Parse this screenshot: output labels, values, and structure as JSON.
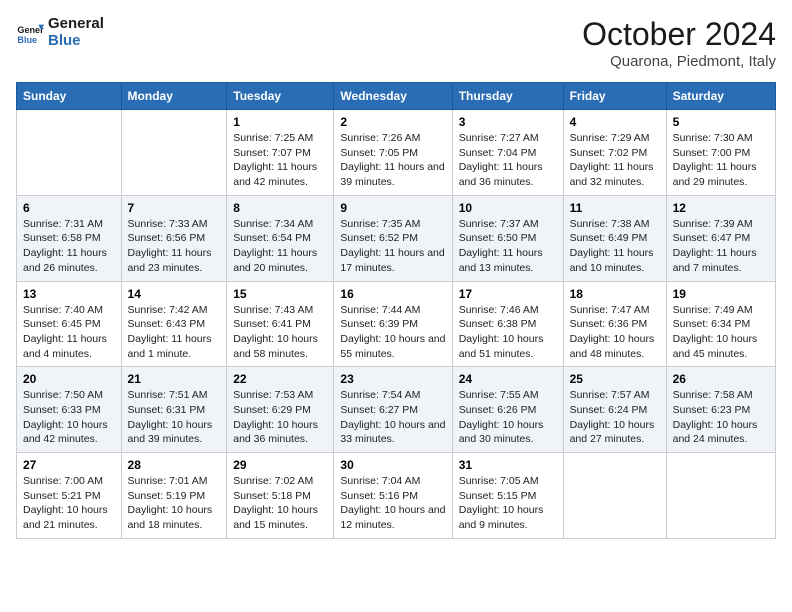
{
  "header": {
    "logo_line1": "General",
    "logo_line2": "Blue",
    "title": "October 2024",
    "subtitle": "Quarona, Piedmont, Italy"
  },
  "days_of_week": [
    "Sunday",
    "Monday",
    "Tuesday",
    "Wednesday",
    "Thursday",
    "Friday",
    "Saturday"
  ],
  "weeks": [
    [
      {
        "day": "",
        "info": ""
      },
      {
        "day": "",
        "info": ""
      },
      {
        "day": "1",
        "info": "Sunrise: 7:25 AM\nSunset: 7:07 PM\nDaylight: 11 hours and 42 minutes."
      },
      {
        "day": "2",
        "info": "Sunrise: 7:26 AM\nSunset: 7:05 PM\nDaylight: 11 hours and 39 minutes."
      },
      {
        "day": "3",
        "info": "Sunrise: 7:27 AM\nSunset: 7:04 PM\nDaylight: 11 hours and 36 minutes."
      },
      {
        "day": "4",
        "info": "Sunrise: 7:29 AM\nSunset: 7:02 PM\nDaylight: 11 hours and 32 minutes."
      },
      {
        "day": "5",
        "info": "Sunrise: 7:30 AM\nSunset: 7:00 PM\nDaylight: 11 hours and 29 minutes."
      }
    ],
    [
      {
        "day": "6",
        "info": "Sunrise: 7:31 AM\nSunset: 6:58 PM\nDaylight: 11 hours and 26 minutes."
      },
      {
        "day": "7",
        "info": "Sunrise: 7:33 AM\nSunset: 6:56 PM\nDaylight: 11 hours and 23 minutes."
      },
      {
        "day": "8",
        "info": "Sunrise: 7:34 AM\nSunset: 6:54 PM\nDaylight: 11 hours and 20 minutes."
      },
      {
        "day": "9",
        "info": "Sunrise: 7:35 AM\nSunset: 6:52 PM\nDaylight: 11 hours and 17 minutes."
      },
      {
        "day": "10",
        "info": "Sunrise: 7:37 AM\nSunset: 6:50 PM\nDaylight: 11 hours and 13 minutes."
      },
      {
        "day": "11",
        "info": "Sunrise: 7:38 AM\nSunset: 6:49 PM\nDaylight: 11 hours and 10 minutes."
      },
      {
        "day": "12",
        "info": "Sunrise: 7:39 AM\nSunset: 6:47 PM\nDaylight: 11 hours and 7 minutes."
      }
    ],
    [
      {
        "day": "13",
        "info": "Sunrise: 7:40 AM\nSunset: 6:45 PM\nDaylight: 11 hours and 4 minutes."
      },
      {
        "day": "14",
        "info": "Sunrise: 7:42 AM\nSunset: 6:43 PM\nDaylight: 11 hours and 1 minute."
      },
      {
        "day": "15",
        "info": "Sunrise: 7:43 AM\nSunset: 6:41 PM\nDaylight: 10 hours and 58 minutes."
      },
      {
        "day": "16",
        "info": "Sunrise: 7:44 AM\nSunset: 6:39 PM\nDaylight: 10 hours and 55 minutes."
      },
      {
        "day": "17",
        "info": "Sunrise: 7:46 AM\nSunset: 6:38 PM\nDaylight: 10 hours and 51 minutes."
      },
      {
        "day": "18",
        "info": "Sunrise: 7:47 AM\nSunset: 6:36 PM\nDaylight: 10 hours and 48 minutes."
      },
      {
        "day": "19",
        "info": "Sunrise: 7:49 AM\nSunset: 6:34 PM\nDaylight: 10 hours and 45 minutes."
      }
    ],
    [
      {
        "day": "20",
        "info": "Sunrise: 7:50 AM\nSunset: 6:33 PM\nDaylight: 10 hours and 42 minutes."
      },
      {
        "day": "21",
        "info": "Sunrise: 7:51 AM\nSunset: 6:31 PM\nDaylight: 10 hours and 39 minutes."
      },
      {
        "day": "22",
        "info": "Sunrise: 7:53 AM\nSunset: 6:29 PM\nDaylight: 10 hours and 36 minutes."
      },
      {
        "day": "23",
        "info": "Sunrise: 7:54 AM\nSunset: 6:27 PM\nDaylight: 10 hours and 33 minutes."
      },
      {
        "day": "24",
        "info": "Sunrise: 7:55 AM\nSunset: 6:26 PM\nDaylight: 10 hours and 30 minutes."
      },
      {
        "day": "25",
        "info": "Sunrise: 7:57 AM\nSunset: 6:24 PM\nDaylight: 10 hours and 27 minutes."
      },
      {
        "day": "26",
        "info": "Sunrise: 7:58 AM\nSunset: 6:23 PM\nDaylight: 10 hours and 24 minutes."
      }
    ],
    [
      {
        "day": "27",
        "info": "Sunrise: 7:00 AM\nSunset: 5:21 PM\nDaylight: 10 hours and 21 minutes."
      },
      {
        "day": "28",
        "info": "Sunrise: 7:01 AM\nSunset: 5:19 PM\nDaylight: 10 hours and 18 minutes."
      },
      {
        "day": "29",
        "info": "Sunrise: 7:02 AM\nSunset: 5:18 PM\nDaylight: 10 hours and 15 minutes."
      },
      {
        "day": "30",
        "info": "Sunrise: 7:04 AM\nSunset: 5:16 PM\nDaylight: 10 hours and 12 minutes."
      },
      {
        "day": "31",
        "info": "Sunrise: 7:05 AM\nSunset: 5:15 PM\nDaylight: 10 hours and 9 minutes."
      },
      {
        "day": "",
        "info": ""
      },
      {
        "day": "",
        "info": ""
      }
    ]
  ]
}
